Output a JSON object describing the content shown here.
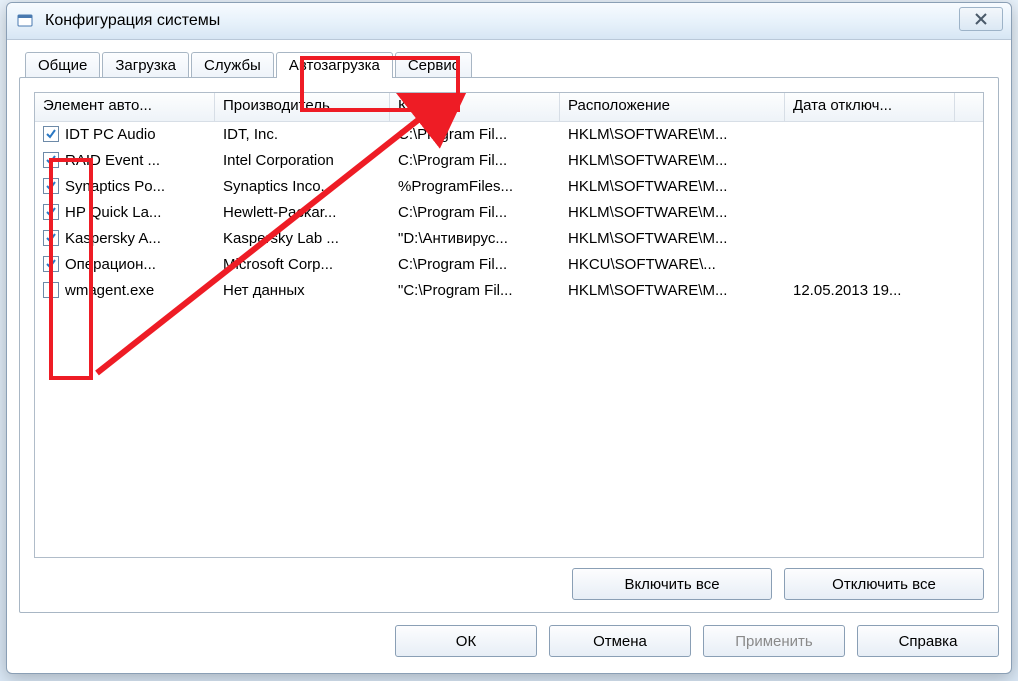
{
  "window": {
    "title": "Конфигурация системы"
  },
  "tabs": {
    "general": "Общие",
    "boot": "Загрузка",
    "services": "Службы",
    "startup": "Автозагрузка",
    "tools": "Сервис",
    "active": "startup"
  },
  "columns": {
    "item": "Элемент авто...",
    "manufacturer": "Производитель",
    "command": "Команда",
    "location": "Расположение",
    "date_disabled": "Дата отключ..."
  },
  "rows": [
    {
      "checked": true,
      "item": "IDT PC Audio",
      "manufacturer": "IDT, Inc.",
      "command": "C:\\Program Fil...",
      "location": "HKLM\\SOFTWARE\\M...",
      "date": ""
    },
    {
      "checked": true,
      "item": "RAID Event ...",
      "manufacturer": "Intel Corporation",
      "command": "C:\\Program Fil...",
      "location": "HKLM\\SOFTWARE\\M...",
      "date": ""
    },
    {
      "checked": true,
      "item": "Synaptics Po...",
      "manufacturer": "Synaptics Inco...",
      "command": "%ProgramFiles...",
      "location": "HKLM\\SOFTWARE\\M...",
      "date": ""
    },
    {
      "checked": true,
      "item": "HP Quick La...",
      "manufacturer": "Hewlett-Packar...",
      "command": "C:\\Program Fil...",
      "location": "HKLM\\SOFTWARE\\M...",
      "date": ""
    },
    {
      "checked": true,
      "item": "Kaspersky A...",
      "manufacturer": "Kaspersky Lab ...",
      "command": "\"D:\\Антивирус...",
      "location": "HKLM\\SOFTWARE\\M...",
      "date": ""
    },
    {
      "checked": true,
      "item": "Операцион...",
      "manufacturer": "Microsoft Corp...",
      "command": "C:\\Program Fil...",
      "location": "HKCU\\SOFTWARE\\...",
      "date": ""
    },
    {
      "checked": false,
      "item": "wmagent.exe",
      "manufacturer": "Нет данных",
      "command": "\"C:\\Program Fil...",
      "location": "HKLM\\SOFTWARE\\M...",
      "date": "12.05.2013 19..."
    }
  ],
  "buttons": {
    "enable_all": "Включить все",
    "disable_all": "Отключить все",
    "ok": "ОК",
    "cancel": "Отмена",
    "apply": "Применить",
    "help": "Справка"
  }
}
